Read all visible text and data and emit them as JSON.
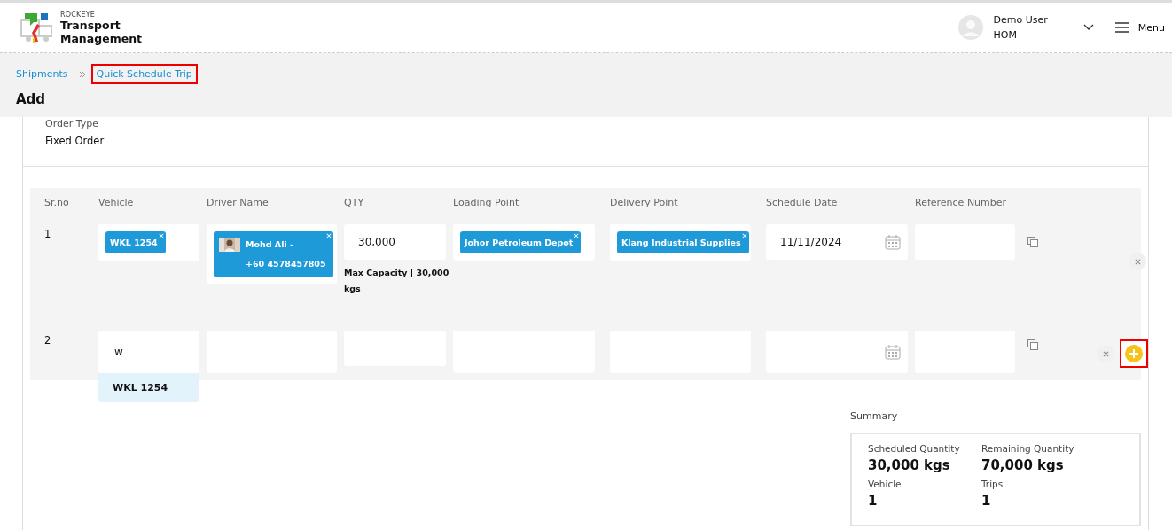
{
  "header": {
    "brand_small": "ROCKEYE",
    "brand_title": "Transport Management",
    "user_name": "Demo User",
    "user_role": "HOM",
    "menu_label": "Menu"
  },
  "breadcrumb": [
    {
      "label": "Shipments",
      "highlighted": false
    },
    {
      "label": "Quick Schedule Trip",
      "highlighted": true
    }
  ],
  "page_title": "Add",
  "order_type": {
    "label": "Order Type",
    "value": "Fixed Order"
  },
  "table": {
    "columns": [
      "Sr.no",
      "Vehicle",
      "Driver Name",
      "QTY",
      "Loading Point",
      "Delivery Point",
      "Schedule Date",
      "Reference Number"
    ],
    "rows": [
      {
        "sr": "1",
        "vehicle": {
          "chips": [
            "WKL 1254"
          ]
        },
        "driver": {
          "name": "Mohd Ali -",
          "phone": "+60 4578457805"
        },
        "qty": "30,000",
        "capacity_note": "Max Capacity | **30,000 kgs**",
        "loading": [
          "Johor Petroleum Depot"
        ],
        "delivery": [
          "Klang Industrial Supplies"
        ],
        "date": "11/11/2024",
        "add_button": null
      },
      {
        "sr": "2",
        "vehicle": {
          "typed": "w",
          "options": [
            "WKL 1254"
          ]
        },
        "add_button": {
          "highlighted": true
        }
      }
    ]
  },
  "summary": {
    "title": "Summary",
    "items": [
      {
        "label": "Scheduled Quantity",
        "value": "30,000 kgs"
      },
      {
        "label": "Remaining Quantity",
        "value": "70,000 kgs"
      },
      {
        "label": "Vehicle",
        "value": "1"
      },
      {
        "label": "Trips",
        "value": "1"
      }
    ]
  }
}
